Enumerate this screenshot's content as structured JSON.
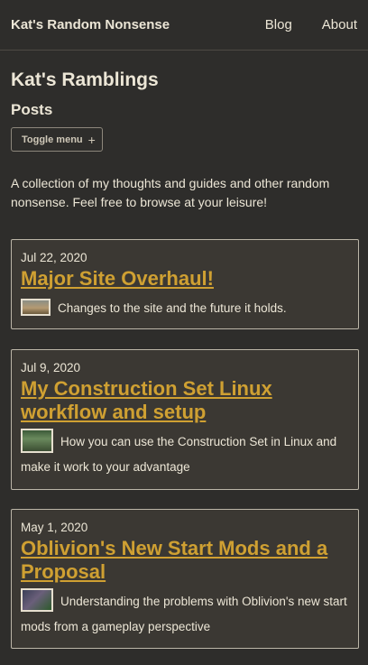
{
  "header": {
    "site_title": "Kat's Random Nonsense",
    "nav": [
      "Blog",
      "About"
    ]
  },
  "main": {
    "page_title": "Kat's Ramblings",
    "posts_heading": "Posts",
    "toggle_label": "Toggle menu",
    "toggle_icon": "+",
    "intro": "A collection of my thoughts and guides and other random nonsense. Feel free to browse at your leisure!"
  },
  "posts": [
    {
      "date": "Jul 22, 2020",
      "title": "Major Site Overhaul!",
      "description": "Changes to the site and the future it holds."
    },
    {
      "date": "Jul 9, 2020",
      "title": "My Construction Set Linux workflow and setup",
      "description": "How you can use the Construction Set in Linux and make it work to your advantage"
    },
    {
      "date": "May 1, 2020",
      "title": "Oblivion's New Start Mods and a Proposal",
      "description": "Understanding the problems with Oblivion's new start mods from a gameplay perspective"
    }
  ],
  "colors": {
    "background": "#2e2d2b",
    "card": "#3b3833",
    "link": "#cfa032",
    "text": "#ece6d6"
  }
}
